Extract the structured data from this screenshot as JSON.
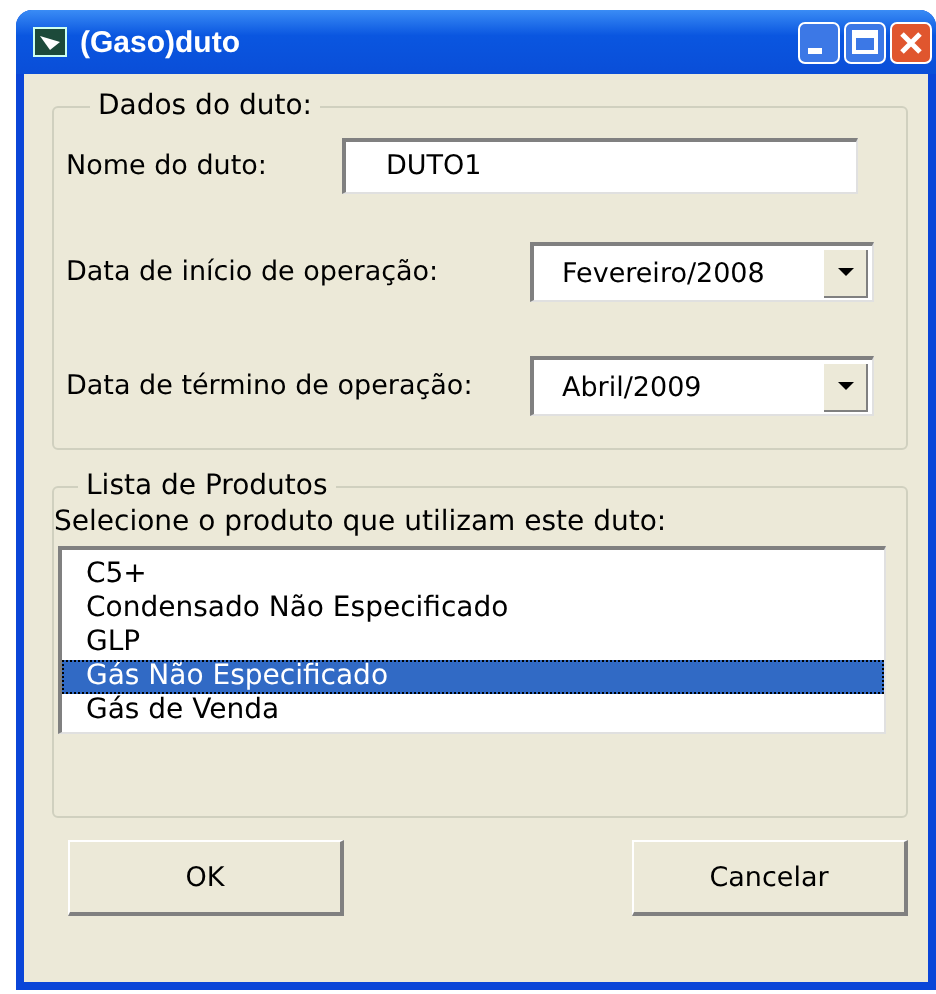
{
  "window": {
    "title": "(Gaso)duto"
  },
  "pipeline_group": {
    "legend": "Dados do duto:",
    "name_field": {
      "label": "Nome do duto:",
      "value": "DUTO1"
    },
    "start_date": {
      "label": "Data de início de operação:",
      "value": "Fevereiro/2008"
    },
    "end_date": {
      "label": "Data de término de operação:",
      "value": "Abril/2009"
    }
  },
  "products_group": {
    "legend": "Lista de Produtos",
    "instruction": "Selecione o produto que utilizam este duto:",
    "items": [
      {
        "label": "C5+",
        "selected": false
      },
      {
        "label": "Condensado Não Especificado",
        "selected": false
      },
      {
        "label": "GLP",
        "selected": false
      },
      {
        "label": "Gás Não Especificado",
        "selected": true
      },
      {
        "label": "Gás de Venda",
        "selected": false
      }
    ]
  },
  "buttons": [
    "OK",
    "Cancelar"
  ]
}
